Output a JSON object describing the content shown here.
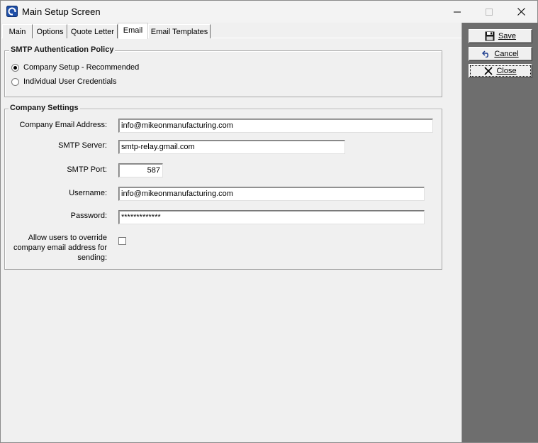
{
  "window": {
    "title": "Main Setup Screen"
  },
  "tabs": [
    {
      "label": "Main"
    },
    {
      "label": "Options"
    },
    {
      "label": "Quote Letter"
    },
    {
      "label": "Email"
    },
    {
      "label": "Email Templates"
    }
  ],
  "active_tab": "Email",
  "smtp_policy": {
    "title": "SMTP Authentication Policy",
    "options": [
      {
        "label": "Company Setup - Recommended",
        "checked": true
      },
      {
        "label": "Individual User Credentials",
        "checked": false
      }
    ]
  },
  "company_settings": {
    "title": "Company Settings",
    "email_label": "Company Email Address:",
    "email_value": "info@mikeonmanufacturing.com",
    "server_label": "SMTP Server:",
    "server_value": "smtp-relay.gmail.com",
    "port_label": "SMTP Port:",
    "port_value": "587",
    "username_label": "Username:",
    "username_value": "info@mikeonmanufacturing.com",
    "password_label": "Password:",
    "password_value": "*************",
    "override_label_lines": [
      "Allow users to override",
      "company email address for",
      "sending:"
    ],
    "override_checked": false
  },
  "buttons": {
    "save": "Save",
    "cancel": "Cancel",
    "close": "Close"
  },
  "icons": {
    "app": "app-icon",
    "save": "floppy-disk-icon",
    "cancel": "undo-arrow-icon",
    "close": "x-close-icon"
  }
}
